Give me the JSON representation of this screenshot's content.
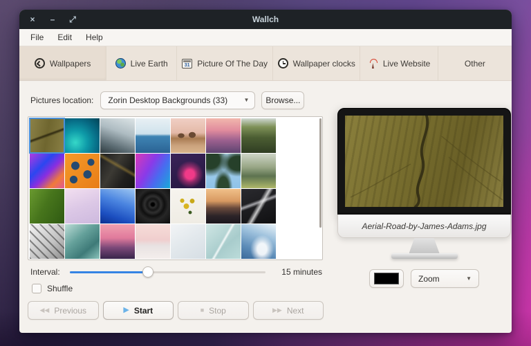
{
  "window": {
    "title": "Wallch",
    "close_glyph": "×",
    "minimize_glyph": "–",
    "maximize_glyph": "⤢"
  },
  "menu": {
    "items": [
      "File",
      "Edit",
      "Help"
    ]
  },
  "tabs": [
    {
      "label": "Wallpapers",
      "icon": "wallpapers-icon",
      "active": true
    },
    {
      "label": "Live Earth",
      "icon": "globe-icon",
      "active": false
    },
    {
      "label": "Picture Of The Day",
      "icon": "calendar-icon",
      "active": false
    },
    {
      "label": "Wallpaper clocks",
      "icon": "clock-icon",
      "active": false
    },
    {
      "label": "Live Website",
      "icon": "antenna-icon",
      "active": false
    },
    {
      "label": "Other",
      "icon": "none",
      "active": false
    }
  ],
  "wallpapers": {
    "location_label": "Pictures location:",
    "location_value": "Zorin Desktop Backgrounds (33)",
    "browse_label": "Browse...",
    "interval_label": "Interval:",
    "interval_value": "15 minutes",
    "interval_percent": 40,
    "shuffle_label": "Shuffle",
    "shuffle_checked": false,
    "thumbnails": [
      {
        "name": "aerial-road",
        "selected": true,
        "bg": "linear-gradient(160deg, rgba(30,25,8,0) 45%, rgba(35,30,10,0.85) 49%, rgba(30,25,8,0) 54%), linear-gradient(100deg, #8c8248 0%, #6f662f 50%, #8a8045 100%)"
      },
      {
        "name": "teal-wave",
        "selected": false,
        "bg": "radial-gradient(circle at 30% 70%, #36d8c8 0%, #0e9aa8 35%, #076c86 65%, #024457 100%)"
      },
      {
        "name": "beach-wave",
        "selected": false,
        "bg": "linear-gradient(200deg, #dce4e6 0%, #aebcc2 40%, #5d6d74 75%, #2e3b40 100%)"
      },
      {
        "name": "ocean-horizon",
        "selected": false,
        "bg": "linear-gradient(180deg, #e8f0f4 0%, #cfe2ec 45%, #3f84b4 52%, #2a6394 100%)"
      },
      {
        "name": "desert-buttes",
        "selected": false,
        "bg": "radial-gradient(ellipse at 30% 50%, #6b4a33 0 9%, transparent 10%), radial-gradient(ellipse at 62% 48%, #6b4a33 0 11%, transparent 12%), linear-gradient(180deg, #f0cfc4 0%, #e4b9a8 42%, #a97b52 58%, #caa27c 78%, #d9b48c 100%)"
      },
      {
        "name": "city-sunset",
        "selected": false,
        "bg": "linear-gradient(180deg, #f2b7ad 0%, #e08b9d 35%, #9f6290 62%, #5d4370 100%)"
      },
      {
        "name": "waterfall-canyon",
        "selected": false,
        "bg": "linear-gradient(180deg, #cfd8d2 0%, #7e9157 25%, #4c5e33 55%, #2f3d22 100%)"
      },
      {
        "name": "abstract-geometric",
        "selected": false,
        "bg": "linear-gradient(135deg, #b23ae0 0%, #2b46f0 35%, #8a2ee0 55%, #f07a3a 78%, #e0589a 100%)"
      },
      {
        "name": "orange-droplets",
        "selected": false,
        "bg": "radial-gradient(circle at 30% 35%, #254a70 0 12%, transparent 13%), radial-gradient(circle at 65% 60%, #254a70 0 13%, transparent 14%), radial-gradient(circle at 75% 25%, #254a70 0 9%, transparent 10%), radial-gradient(circle at 25% 75%, #254a70 0 10%, transparent 11%), linear-gradient(135deg, #f49a28 0%, #e87d18 100%)"
      },
      {
        "name": "dark-streaks",
        "selected": false,
        "bg": "linear-gradient(30deg, transparent 55%, rgba(210,170,60,0.4) 60%, transparent 66%), linear-gradient(120deg, #1c1c1c 0%, #3c3a34 40%, #201f1d 70%, #141414 100%)"
      },
      {
        "name": "abstract-wave",
        "selected": false,
        "bg": "linear-gradient(120deg, #d83ab8 0%, #8a3ae8 40%, #4a6af0 65%, #18aad8 100%)"
      },
      {
        "name": "purple-pink-blob",
        "selected": false,
        "bg": "radial-gradient(circle at 55% 60%, #f03a88 0 16%, rgba(240,58,136,0.5) 28%, transparent 48%), linear-gradient(160deg, #3a2458 0%, #241640 100%)"
      },
      {
        "name": "palm-leaves",
        "selected": false,
        "bg": "radial-gradient(ellipse at 12% 18%, #26402a 0 22%, transparent 42%), radial-gradient(ellipse at 92% 28%, #26402a 0 20%, transparent 38%), radial-gradient(ellipse at 50% 98%, #2c4830 0 22%, transparent 38%), linear-gradient(180deg, #aed6f0 0%, #8ec2e8 100%)"
      },
      {
        "name": "mountain-lake",
        "selected": false,
        "bg": "linear-gradient(180deg, #cdd4c6 0%, #97a584 40%, #5d7350 65%, #8a9a5e 85%, #b0b86a 100%)"
      },
      {
        "name": "green-leaf",
        "selected": false,
        "bg": "linear-gradient(120deg, #6a9a30 0%, #47751c 45%, #2f5a12 100%)"
      },
      {
        "name": "pink-soft-texture",
        "selected": false,
        "bg": "linear-gradient(160deg, #f2dff0 0%, #dcc8e6 50%, #cdb9de 100%)"
      },
      {
        "name": "blue-ice-crystals",
        "selected": false,
        "bg": "linear-gradient(200deg, #9cc6f2 0%, #4a84e0 40%, #1c4fc0 75%, #0c2f90 100%)"
      },
      {
        "name": "water-drop-ripple",
        "selected": false,
        "bg": "radial-gradient(circle at 50% 45%, #000 0 6%, #2e2e2e 12%, #151515 22%, #303030 32%, #101010 45%, #262626 60%, #0c0c0c 100%)"
      },
      {
        "name": "yellow-flowers",
        "selected": false,
        "bg": "radial-gradient(circle at 45% 50%, #d8b422 0 10%, transparent 11%), radial-gradient(circle at 62% 35%, #c8a818 0 7%, transparent 8%), radial-gradient(circle at 33% 34%, #d0b020 0 6%, transparent 7%), radial-gradient(circle at 56% 68%, #3a5a20 0 5%, transparent 6%), linear-gradient(180deg, #f6f4ee 0%, #efece4 100%)"
      },
      {
        "name": "mountain-dusk",
        "selected": false,
        "bg": "linear-gradient(180deg, #f0c089 0%, #d89a62 35%, #6a4a3c 55%, #2c2428 78%, #1c181e 100%)"
      },
      {
        "name": "crystal-shards",
        "selected": false,
        "bg": "linear-gradient(300deg, transparent 40%, rgba(240,240,240,0.8) 47%, transparent 55%), linear-gradient(340deg, transparent 52%, rgba(220,220,225,0.7) 58%, transparent 64%), linear-gradient(160deg, #2a2a2e 0%, #101012 100%)"
      },
      {
        "name": "dot-mesh",
        "selected": false,
        "bg": "repeating-linear-gradient(45deg, rgba(40,40,40,0.5) 0 2px, transparent 2px 9px), linear-gradient(135deg, #f2f2f2 0%, #c2c2c2 60%, #8e8e8e 100%)"
      },
      {
        "name": "teal-ice",
        "selected": false,
        "bg": "linear-gradient(140deg, #bcdcd6 0%, #64a09a 40%, #3e7a78 70%, #8cc4bc 100%)"
      },
      {
        "name": "lighthouse-sunset",
        "selected": false,
        "bg": "linear-gradient(180deg, #f0a0b0 0%, #e07a9c 40%, #7a4878 68%, #38244a 100%)"
      },
      {
        "name": "pink-dunes",
        "selected": false,
        "bg": "linear-gradient(180deg, #f6dcd8 0%, #f0cece 45%, #e8e2e2 62%, #f4eeec 100%)"
      },
      {
        "name": "white-waves",
        "selected": false,
        "bg": "linear-gradient(150deg, #f2f4f6 0%, #e2e8ec 50%, #d6dee4 100%)"
      },
      {
        "name": "pale-ice-lines",
        "selected": false,
        "bg": "linear-gradient(300deg, transparent 46%, rgba(255,255,255,0.85) 50%, transparent 54%), linear-gradient(140deg, #cfe6e4 0%, #a8cccc 60%, #bcdcda 100%)"
      },
      {
        "name": "snowy-peak",
        "selected": false,
        "bg": "radial-gradient(ellipse at 60% 72%, rgba(255,255,255,0.9) 0 16%, transparent 40%), linear-gradient(200deg, #e8f2f8 0%, #9cc0dc 35%, #5c8cb8 70%, #3a6a9a 100%)"
      }
    ],
    "transport": [
      {
        "label": "Previous",
        "icon": "previous-icon",
        "glyph": "◀◀",
        "enabled": false
      },
      {
        "label": "Start",
        "icon": "start-icon",
        "glyph": "▶",
        "enabled": true
      },
      {
        "label": "Stop",
        "icon": "stop-icon",
        "glyph": "■",
        "enabled": false
      },
      {
        "label": "Next",
        "icon": "next-icon",
        "glyph": "▶▶",
        "enabled": false
      }
    ]
  },
  "preview": {
    "filename": "Aerial-Road-by-James-Adams.jpg",
    "swatch_color": "#000000",
    "zoom_value": "Zoom",
    "screen_bg": "repeating-linear-gradient(100deg, rgba(50,45,15,0.18) 0 3px, transparent 3px 10px), linear-gradient(110deg, #8a7f3c 0%, #776d2e 40%, #695f26 70%, #8a7f40 100%)"
  },
  "colors": {
    "accent": "#3584e4",
    "titlebar": "#1e2226",
    "tabbar": "#ece4db",
    "content_bg": "#f4f1ed",
    "selection": "#4a90d9"
  }
}
